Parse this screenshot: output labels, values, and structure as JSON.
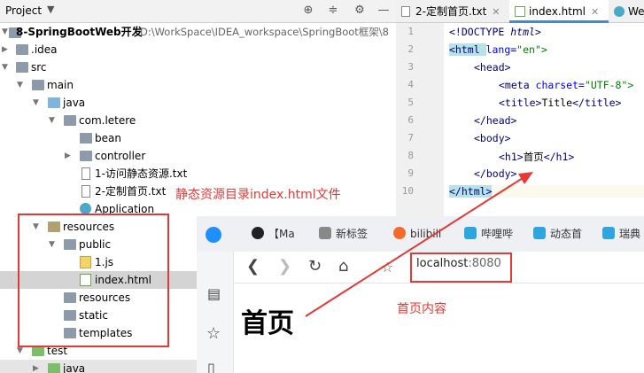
{
  "project_panel": {
    "title": "Project",
    "items": [
      {
        "label": "8-SpringBootWeb开发",
        "path": "D:\\WorkSpace\\IDEA_workspace\\SpringBoot框架\\8"
      },
      {
        "label": ".idea"
      },
      {
        "label": "src"
      },
      {
        "label": "main"
      },
      {
        "label": "java"
      },
      {
        "label": "com.letere"
      },
      {
        "label": "bean"
      },
      {
        "label": "controller"
      },
      {
        "label": "1-访问静态资源.txt"
      },
      {
        "label": "2-定制首页.txt"
      },
      {
        "label": "Application"
      },
      {
        "label": "resources"
      },
      {
        "label": "public"
      },
      {
        "label": "1.js"
      },
      {
        "label": "index.html"
      },
      {
        "label": "resources"
      },
      {
        "label": "static"
      },
      {
        "label": "templates"
      },
      {
        "label": "test"
      },
      {
        "label": "java"
      }
    ]
  },
  "editor": {
    "tabs": [
      {
        "label": "2-定制首页.txt"
      },
      {
        "label": "index.html"
      },
      {
        "label": "We"
      }
    ],
    "line_numbers": [
      "1",
      "2",
      "3",
      "4",
      "5",
      "6",
      "7",
      "8",
      "9",
      "10"
    ],
    "lines": [
      {
        "t1": "<!DOCTYPE ",
        "t2": "html",
        "t3": ">"
      },
      {
        "t1": "<html ",
        "t2": "lang=",
        "t3": "\"en\">"
      },
      {
        "t1": "<head>"
      },
      {
        "t1": "<meta ",
        "t2": "charset=",
        "t3": "\"UTF-8\">"
      },
      {
        "t1": "<title>",
        "t2": "Title",
        "t3": "</title>"
      },
      {
        "t1": "</head>"
      },
      {
        "t1": "<body>"
      },
      {
        "t1": "<h1>",
        "t2": "首页",
        "t3": "</h1>"
      },
      {
        "t1": "</body>"
      },
      {
        "t1": "</html>"
      }
    ]
  },
  "browser": {
    "tabs": [
      "【Ma",
      "新标签",
      "bilibili",
      "哔哩哔",
      "动态首",
      "瑞典"
    ],
    "url_host": "localhost",
    "url_port": ":8080",
    "heading": "首页"
  },
  "annotations": {
    "dir_note": "静态资源目录index.html文件",
    "home_note": "首页内容"
  },
  "colors": {
    "annotation_red": "#e53935",
    "highlight": "#b7e3e8",
    "tab_accent": "#4a88c7"
  }
}
